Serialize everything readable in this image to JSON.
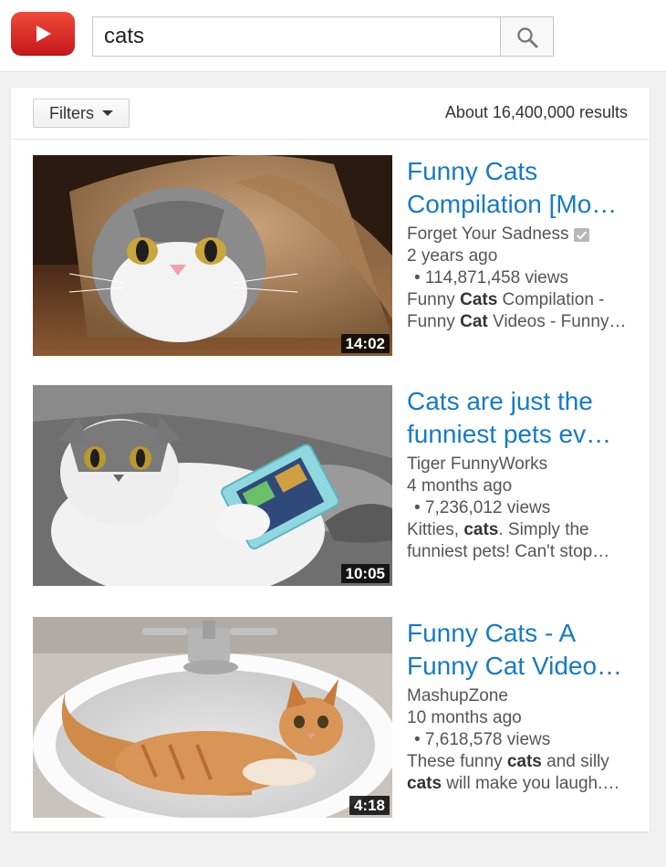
{
  "header": {
    "logo_icon": "youtube-play-logo-icon",
    "search_value": "cats",
    "search_icon": "magnifier-icon"
  },
  "filters": {
    "label": "Filters",
    "results_count": "About 16,400,000 results"
  },
  "colors": {
    "title_link": "#167ac6",
    "logo_red": "#e52d27",
    "page_bg": "#f1f1f1"
  },
  "results": [
    {
      "title_line1": "Funny Cats",
      "title_line2": "Compilation [Mo…",
      "channel": "Forget Your Sadness",
      "verified": true,
      "age": "2 years ago",
      "views": "• 114,871,458 views",
      "desc1_pre": "Funny ",
      "desc1_bold": "Cats",
      "desc1_post": " Compilation -",
      "desc2_pre": "Funny ",
      "desc2_bold": "Cat",
      "desc2_post": " Videos - Funny…",
      "duration": "14:02"
    },
    {
      "title_line1": "Cats are just the",
      "title_line2": "funniest pets ev…",
      "channel": "Tiger FunnyWorks",
      "verified": false,
      "age": "4 months ago",
      "views": "• 7,236,012 views",
      "desc1_pre": "Kitties, ",
      "desc1_bold": "cats",
      "desc1_post": ". Simply the",
      "desc2_pre": "funniest pets! Can't stop…",
      "desc2_bold": "",
      "desc2_post": "",
      "duration": "10:05"
    },
    {
      "title_line1": "Funny Cats - A",
      "title_line2": "Funny Cat Video…",
      "channel": "MashupZone",
      "verified": false,
      "age": "10 months ago",
      "views": "• 7,618,578 views",
      "desc1_pre": "These funny ",
      "desc1_bold": "cats",
      "desc1_post": " and silly",
      "desc2_pre": "",
      "desc2_bold": "cats",
      "desc2_post": " will make you laugh.…",
      "duration": "4:18"
    }
  ]
}
